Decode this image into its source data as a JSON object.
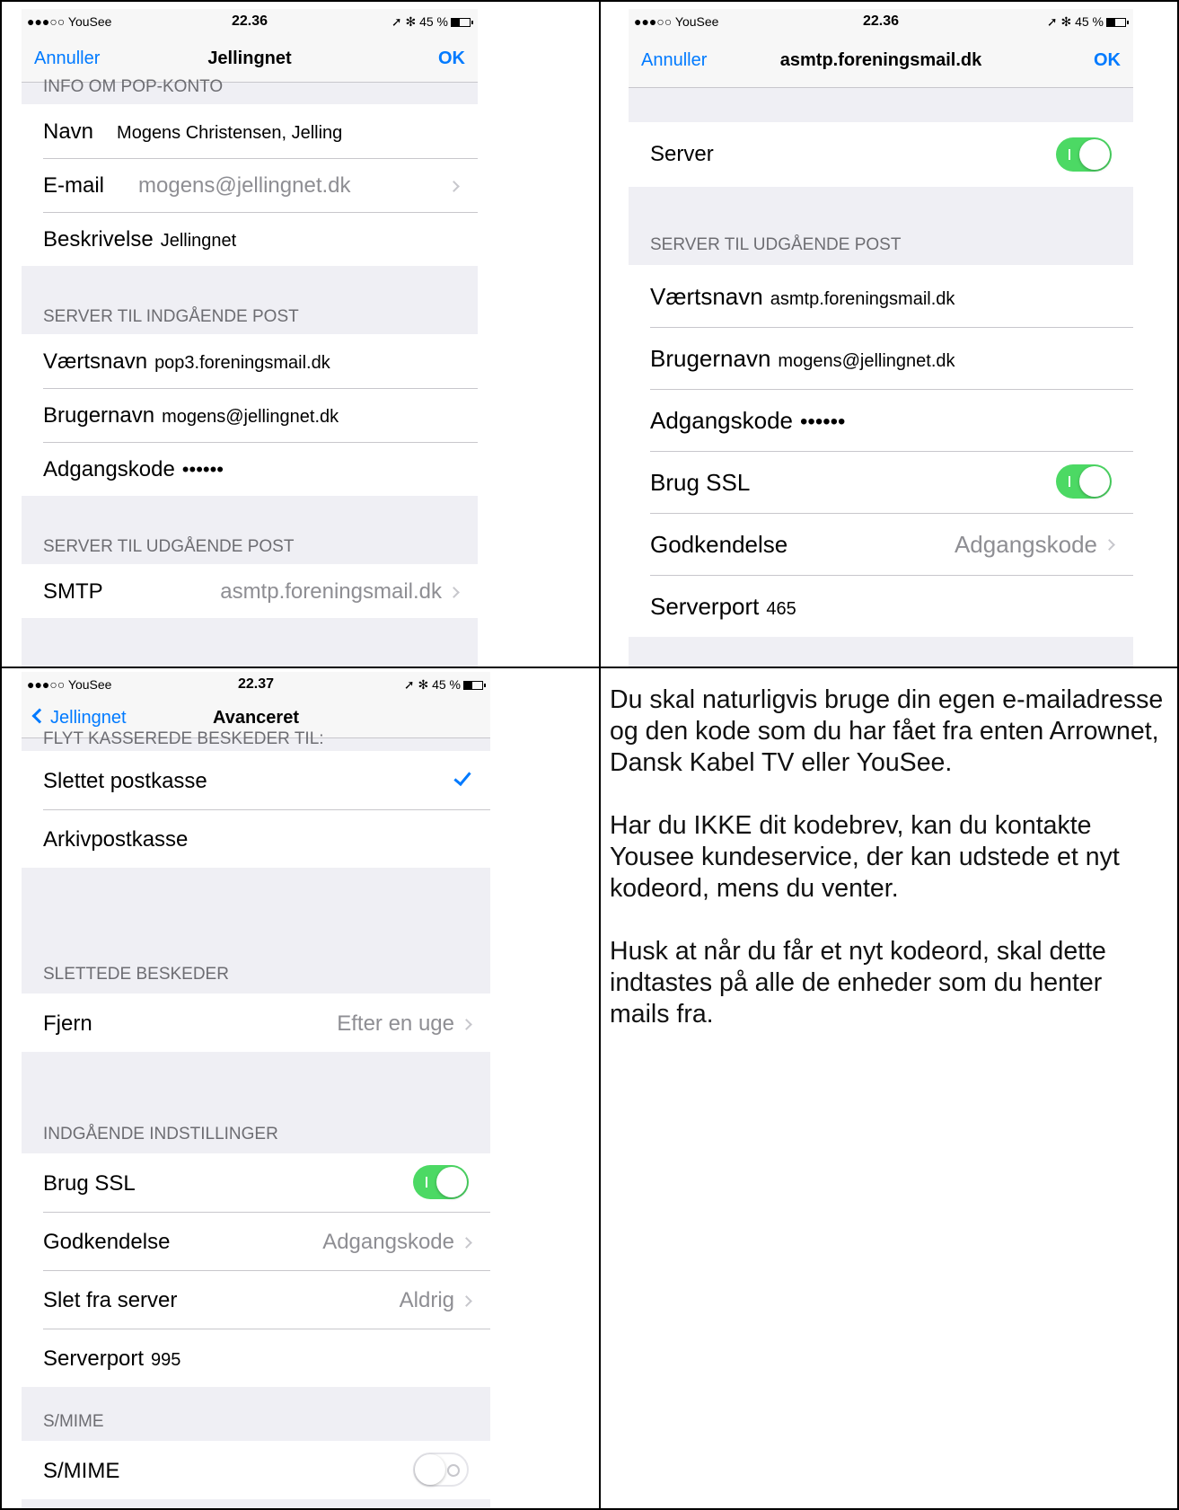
{
  "status": {
    "carrier": "●●●○○ YouSee",
    "wifi": "wifi-icon",
    "time1": "22.36",
    "time2": "22.37",
    "battery": "➚ ✻ 45 %"
  },
  "screen1": {
    "nav": {
      "left": "Annuller",
      "title": "Jellingnet",
      "right": "OK"
    },
    "section_info": "INFO OM POP-KONTO",
    "name": {
      "label": "Navn",
      "value": "Mogens Christensen, Jelling"
    },
    "email": {
      "label": "E-mail",
      "value": "mogens@jellingnet.dk"
    },
    "description": {
      "label": "Beskrivelse",
      "value": "Jellingnet"
    },
    "section_incoming": "SERVER TIL INDGÅENDE POST",
    "host": {
      "label": "Værtsnavn",
      "value": "pop3.foreningsmail.dk"
    },
    "user": {
      "label": "Brugernavn",
      "value": "mogens@jellingnet.dk"
    },
    "password": {
      "label": "Adgangskode",
      "value": "••••••"
    },
    "section_outgoing": "SERVER TIL UDGÅENDE POST",
    "smtp": {
      "label": "SMTP",
      "value": "asmtp.foreningsmail.dk"
    }
  },
  "screen2": {
    "nav": {
      "left": "Annuller",
      "title": "asmtp.foreningsmail.dk",
      "right": "OK"
    },
    "server": {
      "label": "Server",
      "enabled": true
    },
    "section_outgoing": "SERVER TIL UDGÅENDE POST",
    "host": {
      "label": "Værtsnavn",
      "value": "asmtp.foreningsmail.dk"
    },
    "user": {
      "label": "Brugernavn",
      "value": "mogens@jellingnet.dk"
    },
    "password": {
      "label": "Adgangskode",
      "value": "••••••"
    },
    "ssl": {
      "label": "Brug SSL",
      "enabled": true
    },
    "auth": {
      "label": "Godkendelse",
      "value": "Adgangskode"
    },
    "port": {
      "label": "Serverport",
      "value": "465"
    }
  },
  "screen3": {
    "nav": {
      "back": "Jellingnet",
      "title": "Avanceret"
    },
    "section_move": "FLYT KASSEREDE BESKEDER TIL:",
    "deleted_mailbox": "Slettet postkasse",
    "archive_mailbox": "Arkivpostkasse",
    "section_deleted": "SLETTEDE BESKEDER",
    "remove": {
      "label": "Fjern",
      "value": "Efter en uge"
    },
    "section_incoming": "INDGÅENDE INDSTILLINGER",
    "ssl": {
      "label": "Brug SSL",
      "enabled": true
    },
    "auth": {
      "label": "Godkendelse",
      "value": "Adgangskode"
    },
    "delete_from_server": {
      "label": "Slet fra server",
      "value": "Aldrig"
    },
    "port": {
      "label": "Serverport",
      "value": "995"
    },
    "section_smime": "S/MIME",
    "smime": {
      "label": "S/MIME",
      "enabled": false
    }
  },
  "notes": {
    "p1": "Du skal naturligvis bruge din egen e-mailadresse og den kode som du har fået fra enten Arrownet, Dansk Kabel TV eller YouSee.",
    "p2": "Har du IKKE dit kodebrev, kan du kontakte Yousee kundeservice, der kan udstede et nyt kodeord, mens du venter.",
    "p3": "Husk at når du får et nyt kodeord, skal dette indtastes på alle de enheder som du henter mails fra."
  },
  "colors": {
    "accent": "#007aff",
    "toggle_on": "#4cd964",
    "group_bg": "#efeff4",
    "secondary_text": "#8e8e93"
  }
}
